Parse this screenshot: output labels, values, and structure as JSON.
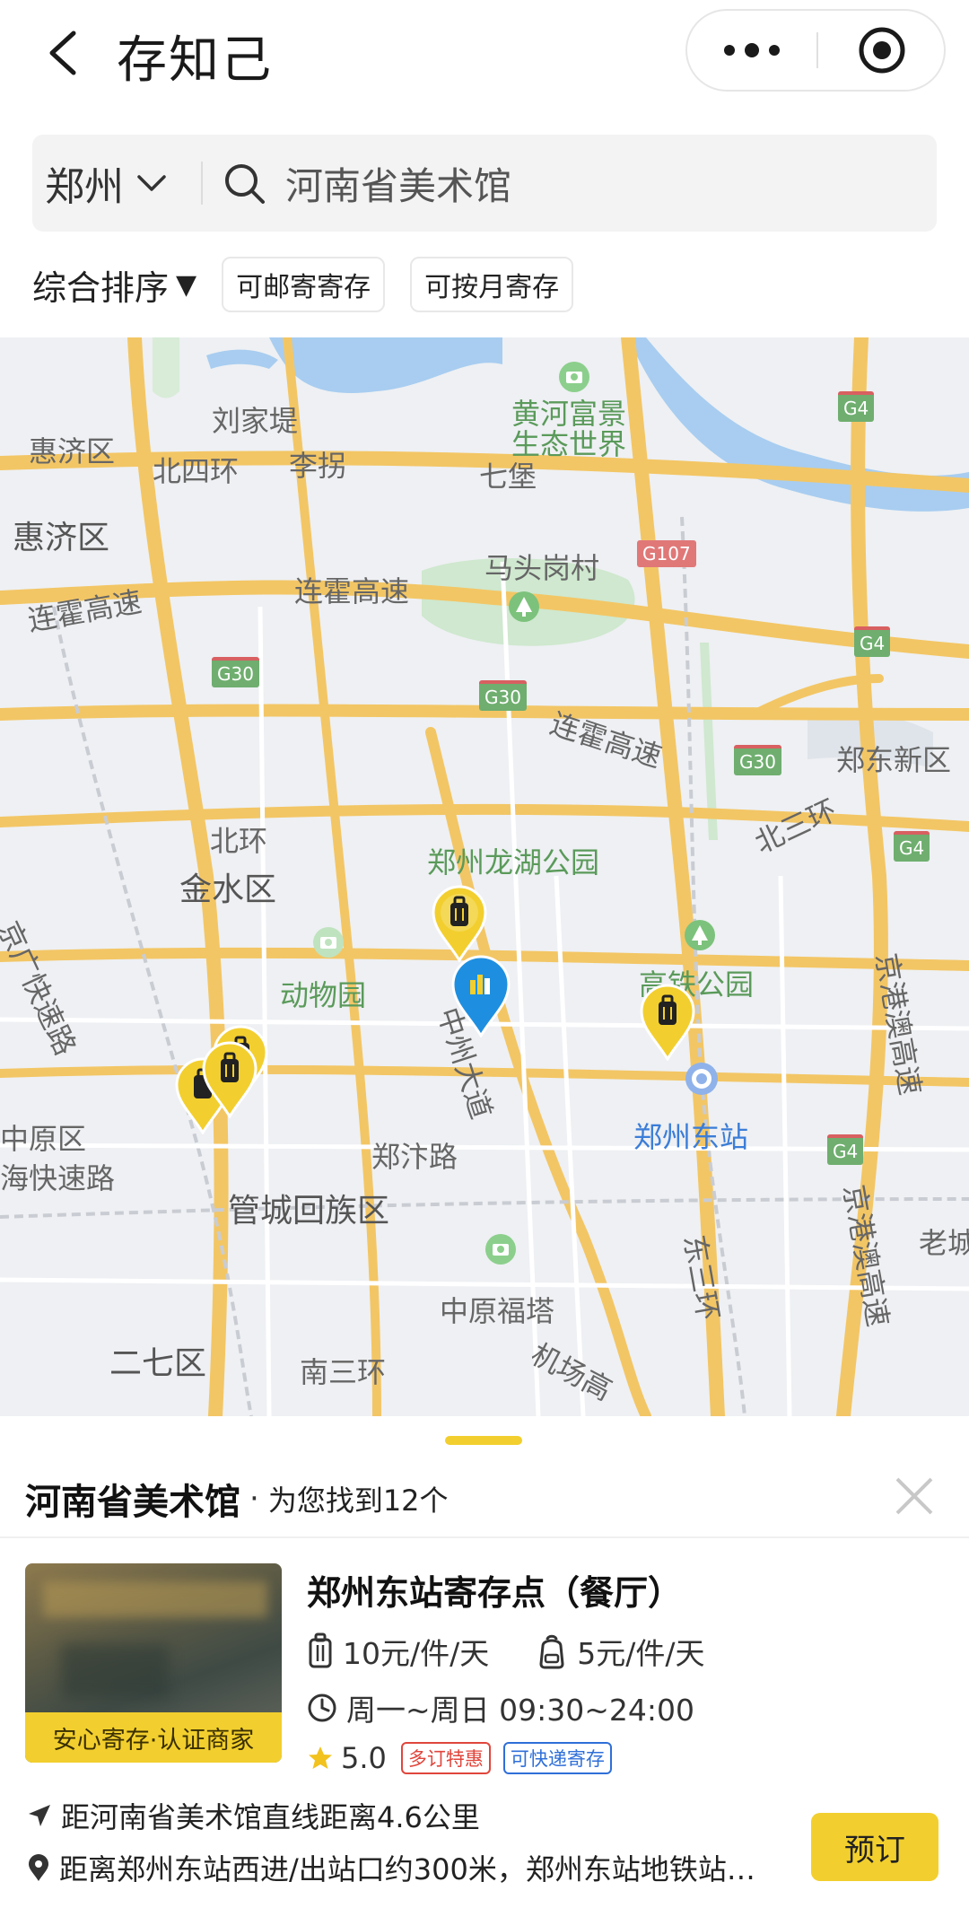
{
  "header": {
    "title": "存知己",
    "back_icon": "back-arrow-icon",
    "more_icon": "more-dots-icon",
    "target_icon": "target-icon"
  },
  "search": {
    "city": "郑州",
    "query": "河南省美术馆"
  },
  "filters": {
    "sort_label": "综合排序",
    "sort_arrow": "▼",
    "chips": [
      "可邮寄寄存",
      "可按月寄存"
    ]
  },
  "map": {
    "labels": {
      "huiji1": "惠济区",
      "liujiadi": "刘家堤",
      "huanghe": "黄河富景",
      "shengtai": "生态世界",
      "beisihuan": "北四环",
      "lizhuang": "李拐",
      "qibao": "七堡",
      "huiji2": "惠济区",
      "matougang": "马头岗村",
      "lianhuo1": "连霍高速",
      "lianhuo2": "连霍高速",
      "lianhuo3": "连霍高速",
      "zhengdong": "郑东新区",
      "beihuan": "北环",
      "longhu": "郑州龙湖公园",
      "jinshui": "金水区",
      "beisanhuan": "北三环",
      "jingguang": "京广快速路",
      "dongwuyuan": "动物园",
      "zhongzhou": "中州大道",
      "gaotie": "高铁公园",
      "jinggangao1": "京港澳高速",
      "zhengzhoudong": "郑州东站",
      "zhongyuan": "中原区",
      "haikuai": "海快速路",
      "zhengbian": "郑汴路",
      "guancheng": "管城回族区",
      "jinggangao2": "京港澳高速",
      "laocheng": "老城",
      "dongsanhuan": "东三环",
      "zhongyuanfuta": "中原福塔",
      "erqi": "二七区",
      "nansanhuan": "南三环",
      "jichang": "机场高"
    },
    "badges": {
      "g4a": "G4",
      "g4b": "G4",
      "g4c": "G4",
      "g4d": "G4",
      "g30a": "G30",
      "g30b": "G30",
      "g30c": "G30",
      "g107": "G107"
    }
  },
  "sheet": {
    "place": "河南省美术馆",
    "found": "为您找到12个",
    "card": {
      "name": "郑州东站寄存点（餐厅）",
      "image_badge": "安心寄存·认证商家",
      "price_large": "10元/件/天",
      "price_small": "5元/件/天",
      "hours": "周一~周日 09:30~24:00",
      "rating": "5.0",
      "tag1": "多订特惠",
      "tag2": "可快递寄存",
      "distance": "距河南省美术馆直线距离4.6公里",
      "address": "距离郑州东站西进/出站口约300米，郑州东站地铁站…",
      "book_label": "预订"
    }
  }
}
